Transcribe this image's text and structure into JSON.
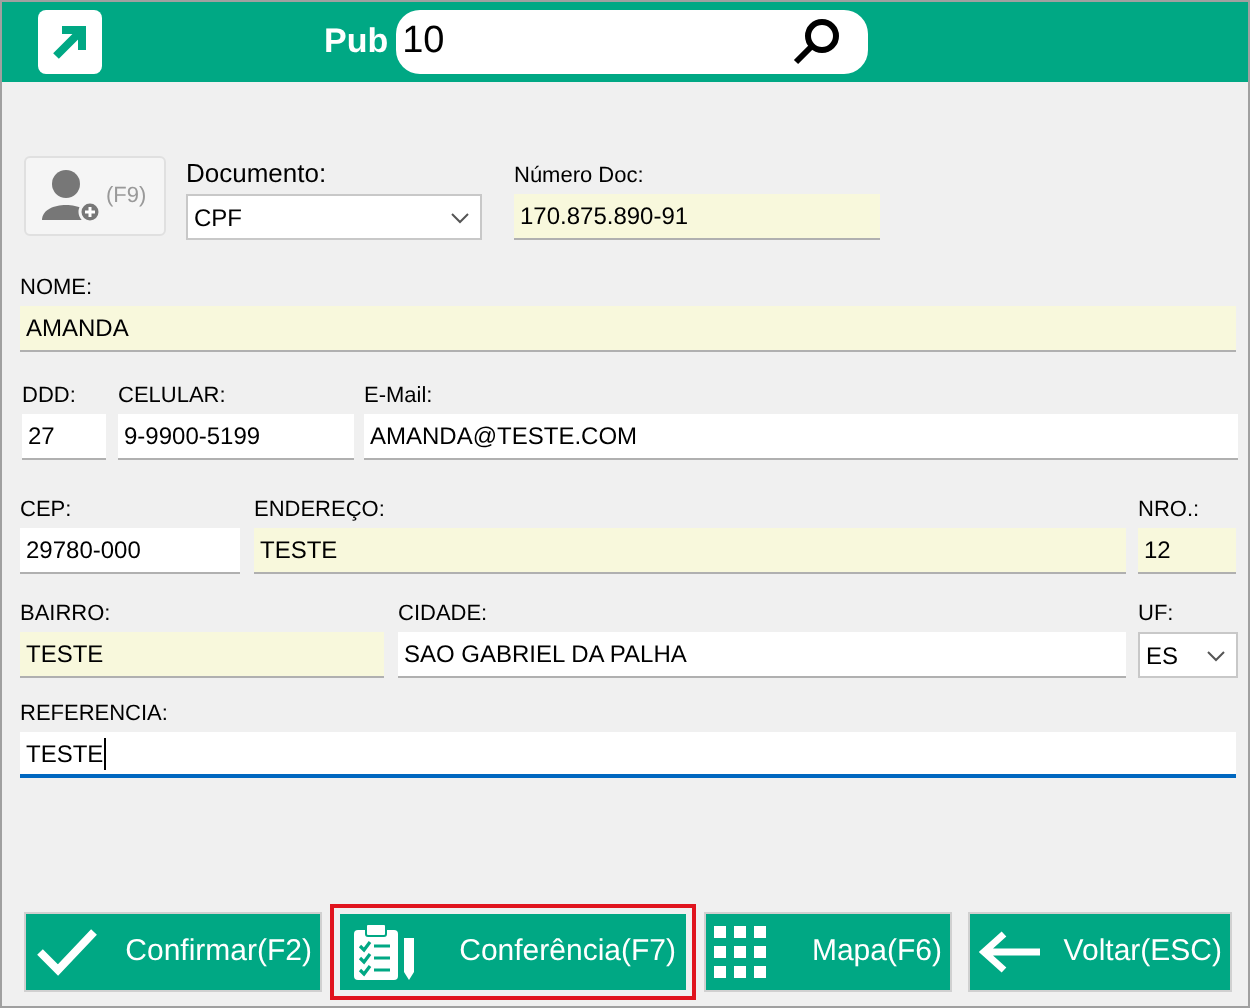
{
  "header": {
    "label": "Pub",
    "search": {
      "value": "10"
    }
  },
  "photo_button": {
    "shortcut": "(F9)"
  },
  "rows": [
    [
      {
        "label": "Documento:",
        "value": "CPF",
        "kind": "select",
        "highlighted": false,
        "focused": false
      },
      {
        "label": "Número Doc:",
        "value": "170.875.890-91",
        "kind": "text",
        "highlighted": true,
        "focused": false
      }
    ],
    [
      {
        "label": "NOME:",
        "value": "AMANDA",
        "kind": "text",
        "highlighted": true,
        "focused": false
      }
    ],
    [
      {
        "label": "DDD:",
        "value": "27",
        "kind": "text",
        "highlighted": false,
        "focused": false
      },
      {
        "label": "CELULAR:",
        "value": "9-9900-5199",
        "kind": "text",
        "highlighted": false,
        "focused": false
      },
      {
        "label": "E-Mail:",
        "value": "AMANDA@TESTE.COM",
        "kind": "text",
        "highlighted": false,
        "focused": false
      }
    ],
    [
      {
        "label": "CEP:",
        "value": "29780-000",
        "kind": "text",
        "highlighted": false,
        "focused": false
      },
      {
        "label": "ENDEREÇO:",
        "value": "TESTE",
        "kind": "text",
        "highlighted": true,
        "focused": false
      },
      {
        "label": "NRO.:",
        "value": "12",
        "kind": "text",
        "highlighted": true,
        "focused": false
      }
    ],
    [
      {
        "label": "BAIRRO:",
        "value": "TESTE",
        "kind": "text",
        "highlighted": true,
        "focused": false
      },
      {
        "label": "CIDADE:",
        "value": "SAO GABRIEL DA PALHA",
        "kind": "text",
        "highlighted": false,
        "focused": false
      },
      {
        "label": "UF:",
        "value": "ES",
        "kind": "select",
        "highlighted": false,
        "focused": false
      }
    ],
    [
      {
        "label": "REFERENCIA:",
        "value": "TESTE",
        "kind": "text",
        "highlighted": false,
        "focused": true
      }
    ]
  ],
  "buttons": [
    {
      "label": "Confirmar(F2)",
      "kind": "check",
      "selected": false
    },
    {
      "label": "Conferência(F7)",
      "kind": "clipboard",
      "selected": true
    },
    {
      "label": "Mapa(F6)",
      "kind": "grid",
      "selected": false
    },
    {
      "label": "Voltar(ESC)",
      "kind": "arrow",
      "selected": false
    }
  ]
}
